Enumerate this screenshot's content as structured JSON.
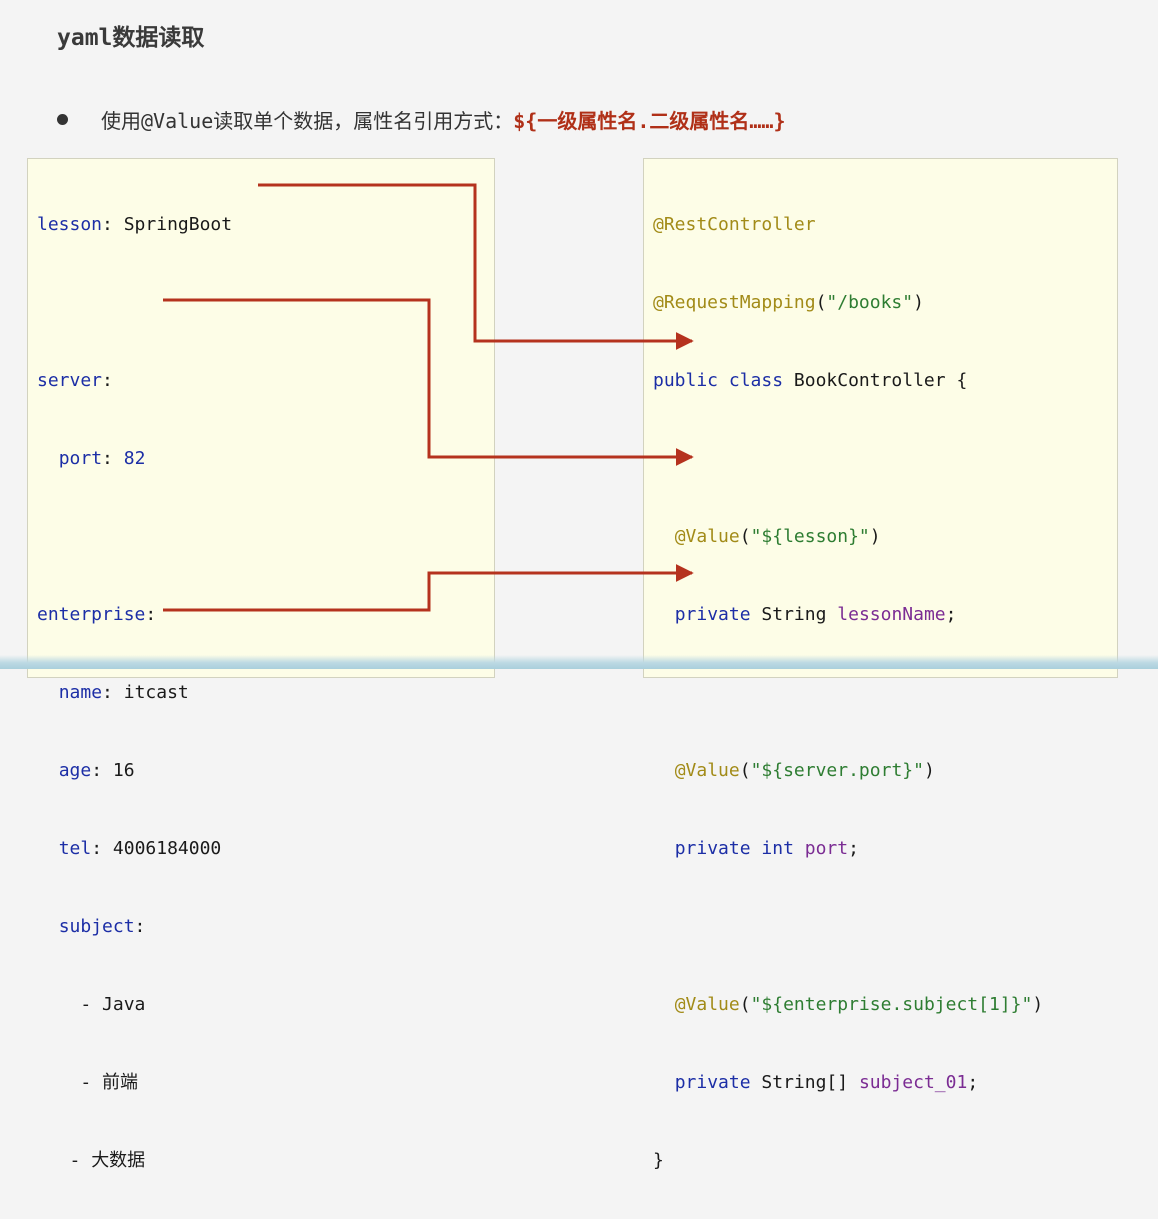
{
  "title": "yaml数据读取",
  "bullet": {
    "text": "使用@Value读取单个数据，属性名引用方式：",
    "highlight": "${一级属性名.二级属性名……}"
  },
  "yaml": {
    "lesson_key": "lesson",
    "lesson_value": "SpringBoot",
    "server_key": "server",
    "port_key": "port",
    "port_value": "82",
    "enterprise_key": "enterprise",
    "name_key": "name",
    "name_value": "itcast",
    "age_key": "age",
    "age_value": "16",
    "tel_key": "tel",
    "tel_value": "4006184000",
    "subject_key": "subject",
    "subject_items": [
      "Java",
      "前端",
      "大数据"
    ]
  },
  "java": {
    "annotation_rest": "@RestController",
    "annotation_mapping": "@RequestMapping",
    "mapping_path": "\"/books\"",
    "class_modifiers": "public class",
    "class_name": "BookController {",
    "value_annotation": "@Value",
    "value1": "\"${lesson}\"",
    "type1": "String",
    "field1": "lessonName",
    "value2": "\"${server.port}\"",
    "type2": "int",
    "field2": "port",
    "value3": "\"${enterprise.subject[1]}\"",
    "type3": "String[]",
    "field3": "subject_01",
    "private_kw": "private",
    "close_brace": "}"
  },
  "colors": {
    "arrow": "#b5321e",
    "key": "#1c2ea6",
    "annotation": "#a28b18",
    "string": "#2e7d32",
    "field": "#7b2c93",
    "panel_bg": "#fdfde7"
  }
}
